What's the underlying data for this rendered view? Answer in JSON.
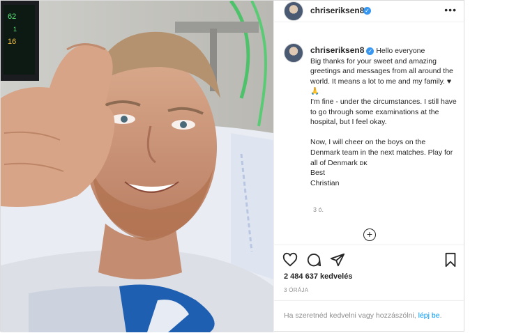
{
  "post": {
    "username": "chriseriksen8",
    "verified_icon": "verified-badge-icon",
    "more_label": "•••",
    "caption_lines": [
      "Hello everyone",
      "Big thanks for your sweet and amazing greetings and messages from all around the world. It means a lot to me and my family. ♥🙏",
      "I'm fine - under the circumstances. I still have to go through some examinations at the hospital, but I feel okay.",
      "",
      "Now, I will cheer on the boys on the Denmark team in the next matches. Play for all of Denmark ᴅᴋ",
      "Best",
      "Christian"
    ],
    "caption_age": "3 ó.",
    "load_more_label": "+",
    "likes": "2 484 637 kedvelés",
    "posted_ago": "3 ÓRÁJA",
    "footer_prefix": "Ha szeretnéd kedvelni vagy hozzászólni,",
    "footer_link": "lépj be",
    "footer_suffix": "."
  },
  "photo": {
    "monitor_values": [
      "62",
      "1",
      "16"
    ]
  },
  "colors": {
    "accent": "#0095f6",
    "verified": "#3897f0",
    "text": "#262626",
    "muted": "#8e8e8e"
  }
}
